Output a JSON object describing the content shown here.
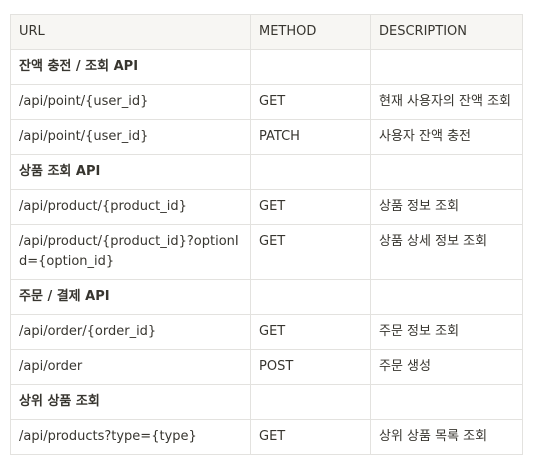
{
  "table": {
    "headers": [
      "URL",
      "METHOD",
      "DESCRIPTION"
    ],
    "rows": [
      {
        "type": "group",
        "url": "잔액 충전 / 조회 API",
        "method": "",
        "description": ""
      },
      {
        "type": "row",
        "url": "/api/point/{user_id}",
        "method": "GET",
        "description": "현재 사용자의 잔액 조회"
      },
      {
        "type": "row",
        "url": "/api/point/{user_id}",
        "method": "PATCH",
        "description": "사용자 잔액 충전"
      },
      {
        "type": "group",
        "url": "상품 조회 API",
        "method": "",
        "description": ""
      },
      {
        "type": "row",
        "url": "/api/product/{product_id}",
        "method": "GET",
        "description": "상품 정보 조회"
      },
      {
        "type": "row",
        "url": "/api/product/{product_id}?optionId={option_id}",
        "method": "GET",
        "description": "상품 상세 정보 조회"
      },
      {
        "type": "group",
        "url": "주문 / 결제 API",
        "method": "",
        "description": ""
      },
      {
        "type": "row",
        "url": "/api/order/{order_id}",
        "method": "GET",
        "description": "주문 정보 조회"
      },
      {
        "type": "row",
        "url": "/api/order",
        "method": "POST",
        "description": "주문 생성"
      },
      {
        "type": "group",
        "url": "상위 상품 조회",
        "method": "",
        "description": ""
      },
      {
        "type": "row",
        "url": "/api/products?type={type}",
        "method": "GET",
        "description": "상위 상품 목록 조회"
      }
    ]
  }
}
